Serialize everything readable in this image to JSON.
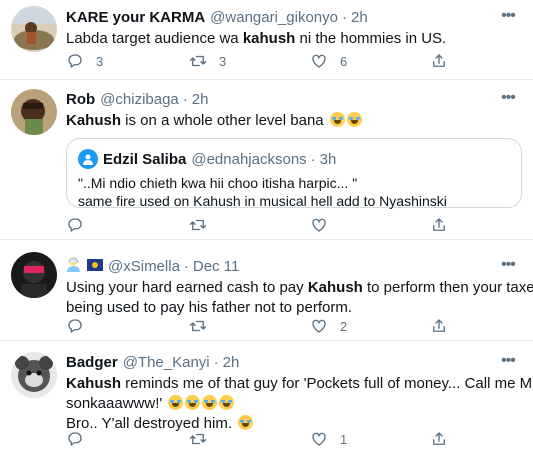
{
  "tweets": [
    {
      "name": "KARE your KARMA",
      "handle": "@wangari_gikonyo",
      "separator": "·",
      "time": "2h",
      "text_pre": "Labda target audience wa ",
      "text_bold": "kahush",
      "text_post": " ni the hommies in  US.",
      "reply_count": "3",
      "retweet_count": "3",
      "like_count": "6"
    },
    {
      "name": "Rob",
      "handle": "@chizibaga",
      "separator": "·",
      "time": "2h",
      "text_bold": "Kahush",
      "text_post": " is on a whole other level bana ",
      "quote": {
        "name": "Edzil Saliba",
        "handle": "@ednahjacksons",
        "separator": "·",
        "time": "3h",
        "line1": "\"..Mi ndio chieth kwa hii choo itisha harpic... \"",
        "line2": "same fire used on Kahush in musical hell add to Nyashinski"
      }
    },
    {
      "name": "",
      "handle": "@xSimella",
      "separator": "·",
      "time": "Dec 11",
      "text_line1_pre": "Using your hard earned cash to pay ",
      "text_line1_bold": "Kahush",
      "text_line1_post": " to perform then your taxes",
      "text_line2": "being used to pay his father not to perform.",
      "like_count": "2"
    },
    {
      "name": "Badger",
      "handle": "@The_Kanyi",
      "separator": "·",
      "time": "2h",
      "text_line1_bold": "Kahush",
      "text_line1_post": " reminds me of that guy for 'Pockets full of money... Call me Mike",
      "text_line2": "sonkaaawww!' ",
      "text_line3": "Bro.. Y'all destroyed him. ",
      "like_count": "1"
    }
  ],
  "colors": {
    "secondary_text": "#5b7083",
    "border": "#e6ecf0",
    "accent": "#1d9bf0"
  },
  "icons": [
    "more-icon",
    "reply-icon",
    "retweet-icon",
    "like-icon",
    "share-icon",
    "face-with-tears-of-joy-emoji"
  ]
}
